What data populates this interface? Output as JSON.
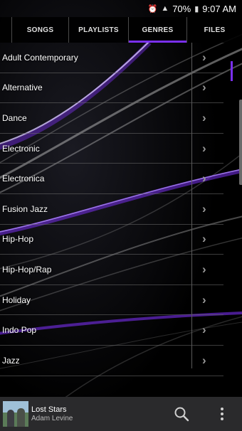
{
  "status_bar": {
    "battery": "70%",
    "time": "9:07 AM",
    "icons": [
      "alarm-icon",
      "signal-icon",
      "battery-icon"
    ]
  },
  "tabs": [
    {
      "label": "SONGS",
      "active": false
    },
    {
      "label": "PLAYLISTS",
      "active": false
    },
    {
      "label": "GENRES",
      "active": true
    },
    {
      "label": "FILES",
      "active": false
    }
  ],
  "genres": [
    "Adult Contemporary",
    "Alternative",
    "Dance",
    "Electronic",
    "Electronica",
    "Fusion Jazz",
    "Hip-Hop",
    "Hip-Hop/Rap",
    "Holiday",
    "Indo Pop",
    "Jazz"
  ],
  "now_playing": {
    "title": "Lost Stars",
    "artist": "Adam Levine"
  },
  "colors": {
    "accent": "#7a2ff0",
    "player_bg": "#2a2a2c",
    "background": "#000000"
  }
}
